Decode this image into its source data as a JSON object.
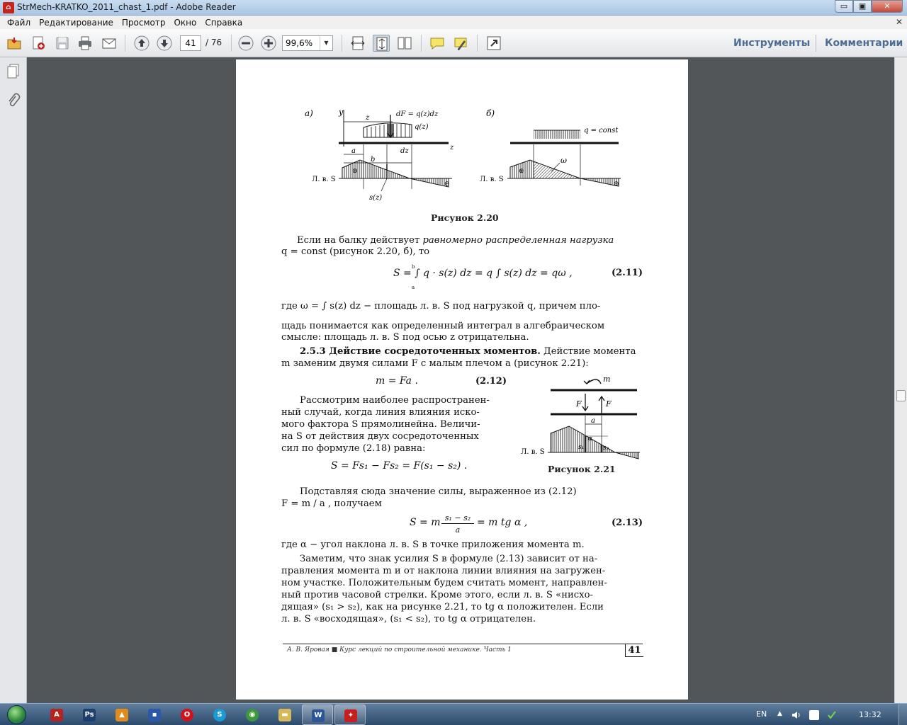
{
  "window": {
    "title": "StrMech-KRATKO_2011_chast_1.pdf - Adobe Reader",
    "minimize": "▭",
    "maximize": "▣",
    "close": "✕"
  },
  "menu": {
    "items": [
      "Файл",
      "Редактирование",
      "Просмотр",
      "Окно",
      "Справка"
    ],
    "close_glyph": "✕"
  },
  "toolbar": {
    "current_page": "41",
    "total_pages": "/ 76",
    "zoom": "99,6%",
    "tools_label": "Инструменты",
    "comments_label": "Комментарии"
  },
  "page": {
    "fig220": {
      "label_a": "а)",
      "label_b": "б)",
      "axis_y": "y",
      "axis_z": "z",
      "dim_z": "z",
      "load_dF": "dF = q(z)dz",
      "load_qz": "q(z)",
      "dim_a": "a",
      "dim_b": "b",
      "dim_dz": "dz",
      "lv_label_left": "Л. в. S",
      "sz_label": "s(z)",
      "q_const": "q = const",
      "omega": "ω",
      "lv_label_right": "Л. в. S",
      "plus": "⊕",
      "minus": "⊖",
      "caption": "Рисунок 2.20"
    },
    "para1_line1_a": "Если на балку действует ",
    "para1_line1_b": "равномерно распределенная нагрузка",
    "para1_line2": "q = const (рисунок 2.20, б), то",
    "eq211": "S = ∫ q · s(z) dz = q ∫ s(z) dz = qω ,",
    "eq211_limits_top": "b",
    "eq211_limits_bottom": "a",
    "eq211_no": "(2.11)",
    "para2_line1": "где  ω = ∫ s(z) dz  − площадь л. в. S под нагрузкой q, причем пло-",
    "para2_line2": "щадь понимается как определенный интеграл в алгебраическом",
    "para2_line3": "смысле: площадь л. в. S под осью z отрицательна.",
    "sec253_bold": "2.5.3 Действие сосредоточенных моментов.",
    "sec253_rest": " Действие момента",
    "sec253_line2": "m заменим двумя силами F с малым плечом a (рисунок 2.21):",
    "eq212": "m = Fa .",
    "eq212_no": "(2.12)",
    "para3_lines": [
      "Рассмотрим наиболее распространен-",
      "ный случай, когда линия влияния иско-",
      "мого фактора S прямолинейна. Величи-",
      "на  S  от действия двух сосредоточенных",
      "сил по формуле (2.18) равна:"
    ],
    "eq_s": "S = Fs₁ − Fs₂ = F(s₁ − s₂) .",
    "fig221": {
      "m": "m",
      "F_left": "F",
      "F_right": "F",
      "a": "a",
      "alpha": "α",
      "s1": "s₁",
      "s2": "s₂",
      "lv_label": "Л. в. S",
      "caption": "Рисунок 2.21"
    },
    "para4_line1": "Подставляя  сюда  значение  силы,  выраженное  из  (2.12)",
    "para4_line2": "F = m / a , получаем",
    "eq213_left": "S = m",
    "eq213_num": "s₁ − s₂",
    "eq213_den": "a",
    "eq213_right": "= m tg α ,",
    "eq213_no": "(2.13)",
    "para5": "где α − угол наклона л. в. S в точке приложения момента m.",
    "para6_lines": [
      "Заметим, что знак усилия S в формуле (2.13) зависит от на-",
      "правления момента m и от наклона линии влияния на загружен-",
      "ном участке. Положительным будем считать момент, направлен-",
      "ный против часовой стрелки. Кроме этого, если л. в. S «нисхо-",
      "дящая» (s₁ > s₂), как на рисунке 2.21, то tg α положителен. Если",
      "л. в. S «восходящая», (s₁ < s₂), то tg α отрицателен."
    ],
    "footer_text": "А. В. Яровая ■ Курс лекций по строительной механике. Часть 1",
    "footer_page": "41"
  },
  "taskbar": {
    "lang": "EN",
    "clock": "13:32",
    "apps": [
      {
        "name": "acrobat-a",
        "glyph": "A",
        "color": "#b5231f"
      },
      {
        "name": "photoshop",
        "glyph": "Ps",
        "color": "#1c3f6e"
      },
      {
        "name": "avast",
        "glyph": "▲",
        "color": "#e08b1c"
      },
      {
        "name": "floppy",
        "glyph": "▪",
        "color": "#2d57a8"
      },
      {
        "name": "opera",
        "glyph": "O",
        "color": "#d1121b"
      },
      {
        "name": "skype",
        "glyph": "S",
        "color": "#1a9ad6"
      },
      {
        "name": "chrome",
        "glyph": "◉",
        "color": "#3d9a3b"
      },
      {
        "name": "explorer",
        "glyph": "▬",
        "color": "#d6b75a"
      },
      {
        "name": "word",
        "glyph": "W",
        "color": "#2b5797"
      },
      {
        "name": "adobe-reader",
        "glyph": "✦",
        "color": "#c51f1f"
      }
    ]
  },
  "colors": {
    "doc_bg": "#525659",
    "accent_links": "#4b6d96"
  }
}
